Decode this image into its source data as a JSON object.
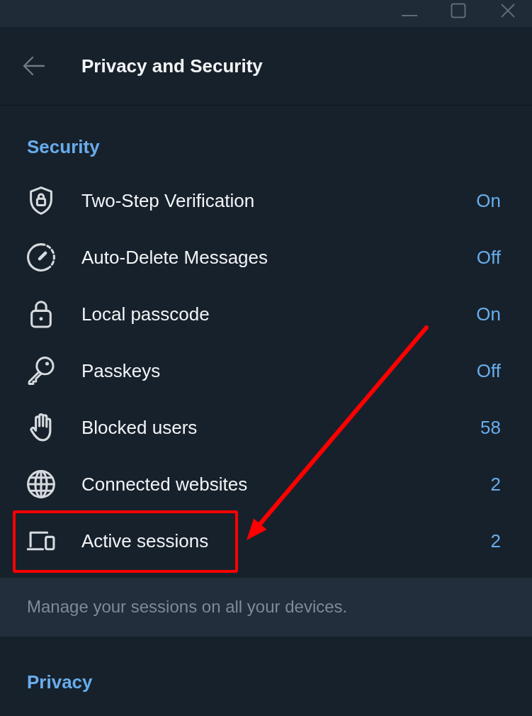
{
  "header": {
    "title": "Privacy and Security"
  },
  "sections": [
    {
      "heading": "Security",
      "items": [
        {
          "label": "Two-Step Verification",
          "value": "On",
          "highlighted": false
        },
        {
          "label": "Auto-Delete Messages",
          "value": "Off",
          "highlighted": false
        },
        {
          "label": "Local passcode",
          "value": "On",
          "highlighted": false
        },
        {
          "label": "Passkeys",
          "value": "Off",
          "highlighted": false
        },
        {
          "label": "Blocked users",
          "value": "58",
          "highlighted": false
        },
        {
          "label": "Connected websites",
          "value": "2",
          "highlighted": false
        },
        {
          "label": "Active sessions",
          "value": "2",
          "highlighted": true
        }
      ],
      "note": "Manage your sessions on all your devices."
    },
    {
      "heading": "Privacy"
    }
  ]
}
